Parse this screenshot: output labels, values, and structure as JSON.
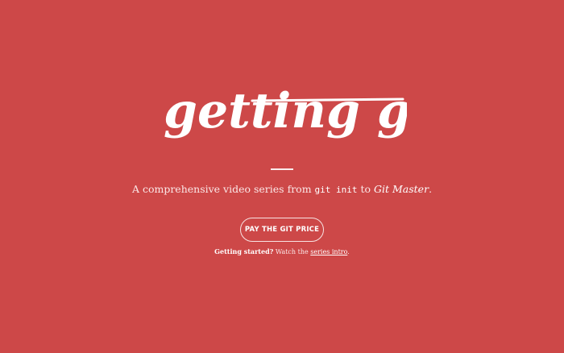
{
  "brand": {
    "logo_text": "getting git"
  },
  "hero": {
    "tagline_prefix": "A comprehensive video series from ",
    "tagline_code": "git init",
    "tagline_mid": " to ",
    "tagline_emphasis": "Git Master",
    "tagline_suffix": "."
  },
  "cta": {
    "label": "PAY THE GIT PRICE"
  },
  "intro": {
    "lead": "Getting started?",
    "text": " Watch the ",
    "link_label": "series intro",
    "suffix": "."
  }
}
